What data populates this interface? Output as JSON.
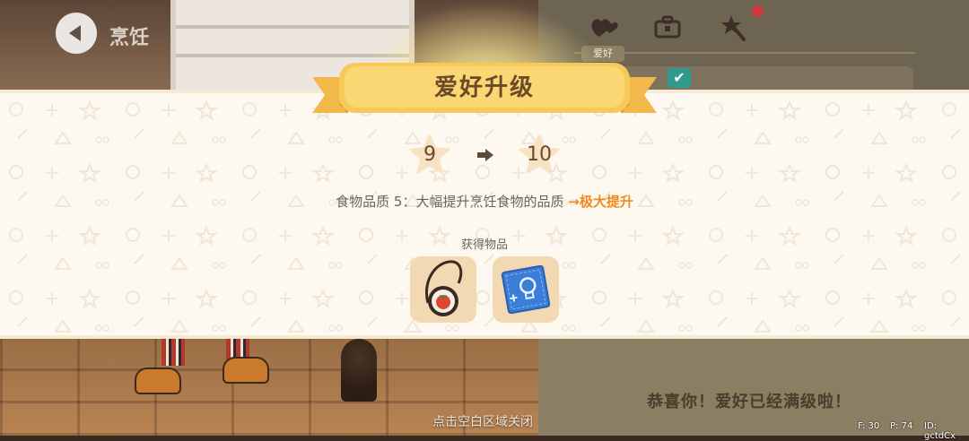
{
  "header": {
    "back_label": "烹饪",
    "tab_label": "爱好"
  },
  "modal": {
    "title": "爱好升级",
    "level_from": "9",
    "level_to": "10",
    "description_prefix": "食物品质 5：大幅提升烹饪食物的品质",
    "description_arrow": "→",
    "description_highlight": "极大提升",
    "rewards_title": "获得物品",
    "rewards": [
      {
        "icon": "handbag-with-tomato-icon"
      },
      {
        "icon": "lightbulb-blueprint-icon"
      }
    ]
  },
  "background": {
    "congrats_text": "恭喜你！爱好已经满级啦！"
  },
  "close_hint": "点击空白区域关闭",
  "debug": {
    "fps": "F: 30",
    "ping": "P: 74",
    "id": "ID: gctdCx"
  },
  "colors": {
    "accent_orange": "#f08a1e",
    "ribbon_yellow": "#f7c95a",
    "band_bg": "#fdf9f0",
    "star_bg": "#f7e2c4"
  }
}
